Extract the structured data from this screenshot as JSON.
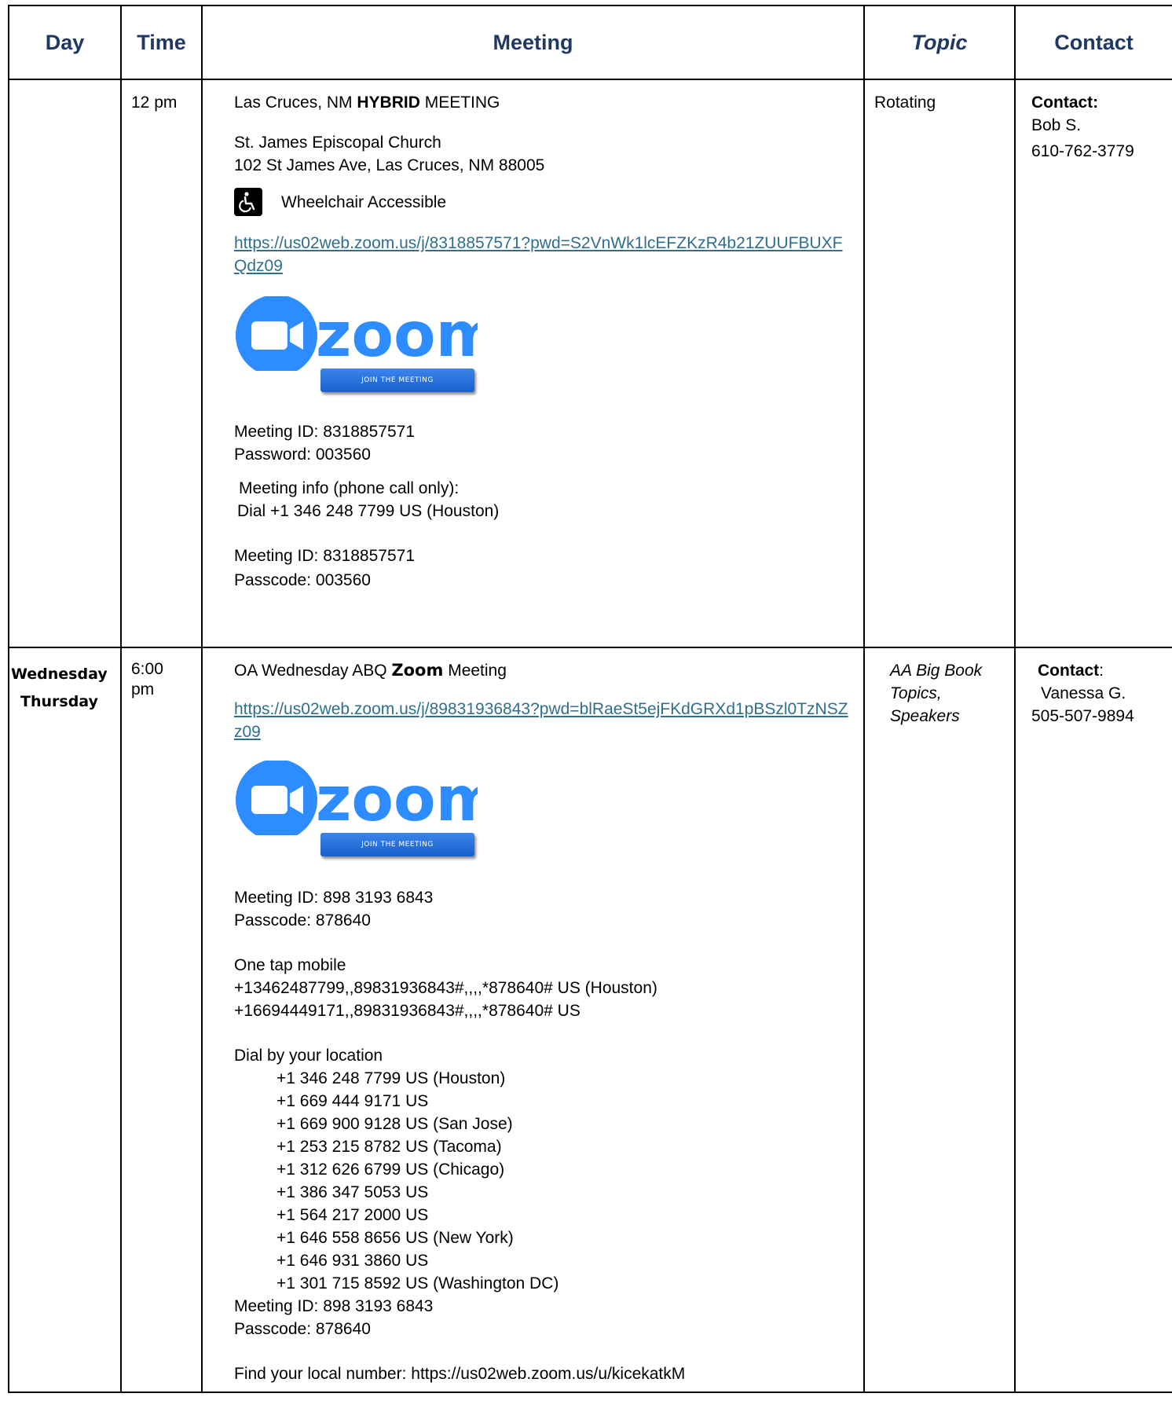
{
  "headers": {
    "day": "Day",
    "time": "Time",
    "meeting": "Meeting",
    "topic": "Topic",
    "contact": "Contact"
  },
  "row1": {
    "day": "",
    "time": "12 pm",
    "title_pre": "Las Cruces, NM ",
    "title_bold": "HYBRID",
    "title_post": " MEETING",
    "venue": "St. James Episcopal Church",
    "address": "102 St James Ave, Las Cruces, NM 88005",
    "accessibility": "Wheelchair Accessible",
    "zoom_link": "https://us02web.zoom.us/j/8318857571?pwd=S2VnWk1lcEFZKzR4b21ZUUFBUXFQdz09",
    "zoom_logo_text": "zoom",
    "zoom_join_text": "JOIN THE MEETING",
    "meeting_id": "Meeting ID: 8318857571",
    "password": "Password: 003560",
    "phone_info": "Meeting info (phone call only):",
    "phone_dial": "Dial +1 346 248 7799 US (Houston)",
    "meeting_id_2": "Meeting ID: 8318857571",
    "passcode": "Passcode: 003560",
    "topic": "Rotating",
    "contact_label": "Contact:",
    "contact_name": "Bob S.",
    "contact_phone": "610-762-3779"
  },
  "row2": {
    "day_1": "Wednesday",
    "day_2": "Thursday",
    "time": "6:00 pm",
    "title_pre": "OA Wednesday ABQ ",
    "title_bold": "Zoom",
    "title_post": " Meeting",
    "zoom_link": "https://us02web.zoom.us/j/89831936843?pwd=blRaeSt5ejFKdGRXd1pBSzl0TzNSZz09",
    "zoom_logo_text": "zoom",
    "zoom_join_text": "JOIN THE MEETING",
    "meeting_id": "Meeting ID: 898 3193 6843",
    "passcode": "Passcode: 878640",
    "one_tap_label": "One tap mobile",
    "one_tap": [
      "+13462487799,,89831936843#,,,,*878640# US (Houston)",
      "+16694449171,,89831936843#,,,,*878640# US"
    ],
    "dial_label": "Dial by your location",
    "dial_numbers": [
      "+1 346 248 7799 US (Houston)",
      "+1 669 444 9171 US",
      "+1 669 900 9128 US (San Jose)",
      "+1 253 215 8782 US (Tacoma)",
      "+1 312 626 6799 US (Chicago)",
      "+1 386 347 5053 US",
      "+1 564 217 2000 US",
      "+1 646 558 8656 US (New York)",
      "+1 646 931 3860 US",
      "+1 301 715 8592 US (Washington DC)"
    ],
    "meeting_id_2": "Meeting ID: 898 3193 6843",
    "passcode_2": "Passcode: 878640",
    "find_local": "Find your local number:  https://us02web.zoom.us/u/kicekatkM",
    "topic_1": "AA Big Book",
    "topic_2": "Topics,",
    "topic_3": "Speakers",
    "contact_label": "Contact",
    "contact_colon": ":",
    "contact_name": "Vanessa G.",
    "contact_phone": "505-507-9894"
  },
  "colors": {
    "header_text": "#1f3864",
    "link": "#2e6f8e",
    "zoom_blue": "#2d8cff",
    "zoom_button": "#1a5fcf"
  },
  "icons": [
    "wheelchair-icon",
    "zoom-camera-icon"
  ]
}
